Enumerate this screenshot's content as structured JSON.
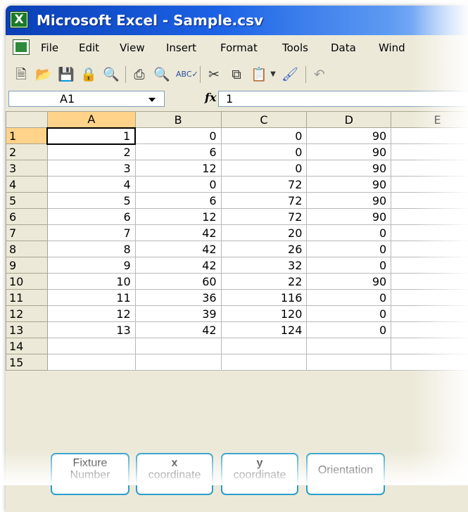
{
  "window": {
    "title": "Microsoft Excel - Sample.csv"
  },
  "menu": [
    "File",
    "Edit",
    "View",
    "Insert",
    "Format",
    "Tools",
    "Data",
    "Wind"
  ],
  "toolbar": {
    "icons": [
      "new-icon",
      "open-icon",
      "save-icon",
      "permission-icon",
      "research-icon",
      "print-icon",
      "print-preview-icon",
      "spelling-icon",
      "cut-icon",
      "copy-icon",
      "paste-icon",
      "paste-dropdown-icon",
      "format-painter-icon",
      "undo-icon"
    ]
  },
  "formula_bar": {
    "name_box": "A1",
    "fx": "fx",
    "value": "1"
  },
  "columns": [
    "A",
    "B",
    "C",
    "D",
    "E"
  ],
  "rows": [
    {
      "n": "1",
      "v": [
        "1",
        "0",
        "0",
        "90",
        ""
      ]
    },
    {
      "n": "2",
      "v": [
        "2",
        "6",
        "0",
        "90",
        ""
      ]
    },
    {
      "n": "3",
      "v": [
        "3",
        "12",
        "0",
        "90",
        ""
      ]
    },
    {
      "n": "4",
      "v": [
        "4",
        "0",
        "72",
        "90",
        ""
      ]
    },
    {
      "n": "5",
      "v": [
        "5",
        "6",
        "72",
        "90",
        ""
      ]
    },
    {
      "n": "6",
      "v": [
        "6",
        "12",
        "72",
        "90",
        ""
      ]
    },
    {
      "n": "7",
      "v": [
        "7",
        "42",
        "20",
        "0",
        ""
      ]
    },
    {
      "n": "8",
      "v": [
        "8",
        "42",
        "26",
        "0",
        ""
      ]
    },
    {
      "n": "9",
      "v": [
        "9",
        "42",
        "32",
        "0",
        ""
      ]
    },
    {
      "n": "10",
      "v": [
        "10",
        "60",
        "22",
        "90",
        ""
      ]
    },
    {
      "n": "11",
      "v": [
        "11",
        "36",
        "116",
        "0",
        ""
      ]
    },
    {
      "n": "12",
      "v": [
        "12",
        "39",
        "120",
        "0",
        ""
      ]
    },
    {
      "n": "13",
      "v": [
        "13",
        "42",
        "124",
        "0",
        ""
      ]
    },
    {
      "n": "14",
      "v": [
        "",
        "",
        "",
        "",
        ""
      ]
    },
    {
      "n": "15",
      "v": [
        "",
        "",
        "",
        "",
        ""
      ]
    }
  ],
  "callouts": {
    "a_line1": "Fixture",
    "a_line2": "Number",
    "b_line1": "x",
    "b_line2": "coordinate",
    "c_line1": "y",
    "c_line2": "coordinate",
    "d_line1": "Orientation"
  },
  "colors": {
    "title_bar": "#1c63e6",
    "selected_header": "#ffd38a",
    "callout_border": "#2b9ec8"
  }
}
